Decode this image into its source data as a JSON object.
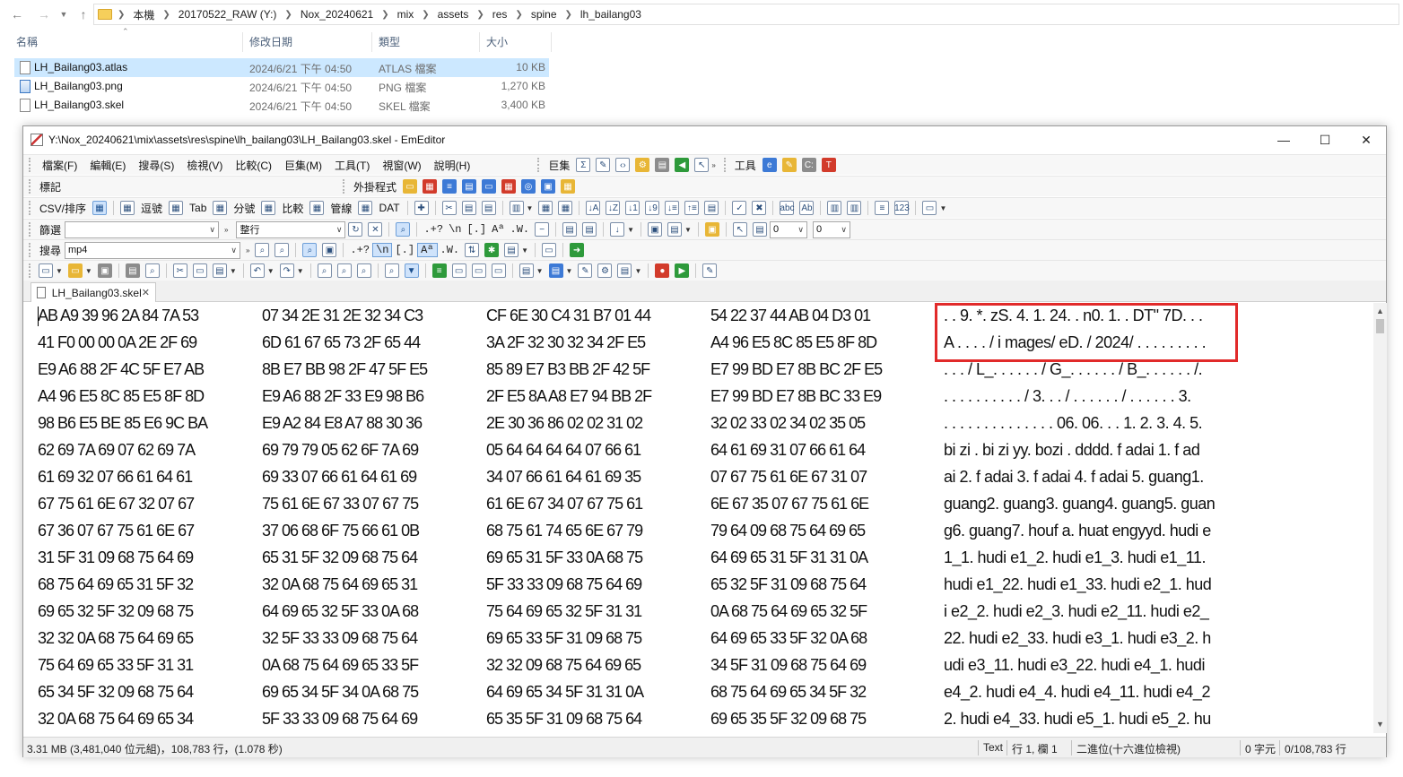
{
  "explorer": {
    "breadcrumbs": [
      "本機",
      "20170522_RAW (Y:)",
      "Nox_20240621",
      "mix",
      "assets",
      "res",
      "spine",
      "lh_bailang03"
    ],
    "columns": {
      "name": "名稱",
      "date": "修改日期",
      "type": "類型",
      "size": "大小"
    },
    "files": [
      {
        "name": "LH_Bailang03.atlas",
        "date": "2024/6/21 下午 04:50",
        "type": "ATLAS 檔案",
        "size": "10 KB",
        "selected": true
      },
      {
        "name": "LH_Bailang03.png",
        "date": "2024/6/21 下午 04:50",
        "type": "PNG 檔案",
        "size": "1,270 KB",
        "selected": false
      },
      {
        "name": "LH_Bailang03.skel",
        "date": "2024/6/21 下午 04:50",
        "type": "SKEL 檔案",
        "size": "3,400 KB",
        "selected": false
      }
    ]
  },
  "editor": {
    "title": "Y:\\Nox_20240621\\mix\\assets\\res\\spine\\lh_bailang03\\LH_Bailang03.skel - EmEditor",
    "menu": [
      "檔案(F)",
      "編輯(E)",
      "搜尋(S)",
      "檢視(V)",
      "比較(C)",
      "巨集(M)",
      "工具(T)",
      "視窗(W)",
      "說明(H)"
    ],
    "macros_label": "巨集",
    "tools_label": "工具",
    "bookmarks_label": "標記",
    "plugins_label": "外掛程式",
    "csv_toolbar": {
      "csv_sort": "CSV/排序",
      "comma": "逗號",
      "tab": "Tab",
      "semicolon": "分號",
      "compare": "比較",
      "pipe": "管線",
      "dat": "DAT"
    },
    "filter": {
      "label": "篩選",
      "value": "",
      "mode": "整行",
      "num1": "0",
      "num2": "0"
    },
    "search": {
      "label": "搜尋",
      "value": "mp4"
    },
    "tab_label": "LH_Bailang03.skel",
    "hex_lines": [
      {
        "hex": [
          "AB A9 39 96 2A 84 7A 53",
          "07 34 2E 31 2E 32 34 C3",
          "CF 6E 30 C4 31 B7 01 44",
          "54 22 37 44 AB 04 D3 01"
        ],
        "ascii": ". . 9. *. zS. 4. 1. 24. . n0. 1. . DT\" 7D. . ."
      },
      {
        "hex": [
          "41 F0 00 00 0A 2E 2F 69",
          "6D 61 67 65 73 2F 65 44",
          "3A 2F 32 30 32 34 2F E5",
          "A4 96 E5 8C 85 E5 8F 8D"
        ],
        "ascii": "A . . . . / i mages/ eD. / 2024/ . . . . . . . . ."
      },
      {
        "hex": [
          "E9 A6 88 2F 4C 5F E7 AB",
          "8B E7 BB 98 2F 47 5F E5",
          "85 89 E7 B3 BB 2F 42 5F",
          "E7 99 BD E7 8B BC 2F E5"
        ],
        "ascii": ". . . / L_. . . . . . / G_. . . . . . / B_. . . . . . /."
      },
      {
        "hex": [
          "A4 96 E5 8C 85 E5 8F 8D",
          "E9 A6 88 2F 33 E9 98 B6",
          "2F E5 8A A8 E7 94 BB 2F",
          "E7 99 BD E7 8B BC 33 E9"
        ],
        "ascii": ". . . . . . . . . . / 3. . . / . . . . . . / . . . . . . 3."
      },
      {
        "hex": [
          "98 B6 E5 BE 85 E6 9C BA",
          "E9 A2 84 E8 A7 88 30 36",
          "2E 30 36 86 02 02 31 02",
          "32 02 33 02 34 02 35 05"
        ],
        "ascii": ". . . . . . . . . . . . . . 06. 06. . . 1. 2. 3. 4. 5."
      },
      {
        "hex": [
          "62 69 7A 69 07 62 69 7A",
          "69 79 79 05 62 6F 7A 69",
          "05 64 64 64 64 07 66 61",
          "64 61 69 31 07 66 61 64"
        ],
        "ascii": "bi zi . bi zi yy. bozi . dddd. f adai 1. f ad"
      },
      {
        "hex": [
          "61 69 32 07 66 61 64 61",
          "69 33 07 66 61 64 61 69",
          "34 07 66 61 64 61 69 35",
          "07 67 75 61 6E 67 31 07"
        ],
        "ascii": "ai 2. f adai 3. f adai 4. f adai 5. guang1."
      },
      {
        "hex": [
          "67 75 61 6E 67 32 07 67",
          "75 61 6E 67 33 07 67 75",
          "61 6E 67 34 07 67 75 61",
          "6E 67 35 07 67 75 61 6E"
        ],
        "ascii": "guang2. guang3. guang4. guang5. guan"
      },
      {
        "hex": [
          "67 36 07 67 75 61 6E 67",
          "37 06 68 6F 75 66 61 0B",
          "68 75 61 74 65 6E 67 79",
          "79 64 09 68 75 64 69 65"
        ],
        "ascii": "g6. guang7. houf a. huat engyyd. hudi e"
      },
      {
        "hex": [
          "31 5F 31 09 68 75 64 69",
          "65 31 5F 32 09 68 75 64",
          "69 65 31 5F 33 0A 68 75",
          "64 69 65 31 5F 31 31 0A"
        ],
        "ascii": "1_1. hudi e1_2. hudi e1_3. hudi e1_11."
      },
      {
        "hex": [
          "68 75 64 69 65 31 5F 32",
          "32 0A 68 75 64 69 65 31",
          "5F 33 33 09 68 75 64 69",
          "65 32 5F 31 09 68 75 64"
        ],
        "ascii": "hudi e1_22. hudi e1_33. hudi e2_1. hud"
      },
      {
        "hex": [
          "69 65 32 5F 32 09 68 75",
          "64 69 65 32 5F 33 0A 68",
          "75 64 69 65 32 5F 31 31",
          "0A 68 75 64 69 65 32 5F"
        ],
        "ascii": "i e2_2. hudi e2_3. hudi e2_11. hudi e2_"
      },
      {
        "hex": [
          "32 32 0A 68 75 64 69 65",
          "32 5F 33 33 09 68 75 64",
          "69 65 33 5F 31 09 68 75",
          "64 69 65 33 5F 32 0A 68"
        ],
        "ascii": "22. hudi e2_33. hudi e3_1. hudi e3_2. h"
      },
      {
        "hex": [
          "75 64 69 65 33 5F 31 31",
          "0A 68 75 64 69 65 33 5F",
          "32 32 09 68 75 64 69 65",
          "34 5F 31 09 68 75 64 69"
        ],
        "ascii": "udi e3_11. hudi e3_22. hudi e4_1. hudi"
      },
      {
        "hex": [
          "65 34 5F 32 09 68 75 64",
          "69 65 34 5F 34 0A 68 75",
          "64 69 65 34 5F 31 31 0A",
          "68 75 64 69 65 34 5F 32"
        ],
        "ascii": "e4_2. hudi e4_4. hudi e4_11. hudi e4_2"
      },
      {
        "hex": [
          "32 0A 68 75 64 69 65 34",
          "5F 33 33 09 68 75 64 69",
          "65 35 5F 31 09 68 75 64",
          "69 65 35 5F 32 09 68 75"
        ],
        "ascii": "2. hudi e4_33. hudi e5_1. hudi e5_2. hu"
      }
    ],
    "status": {
      "size": "3.31 MB (3,481,040 位元組)，108,783 行，(1.078 秒)",
      "mode": "Text",
      "position": "行 1, 欄 1",
      "view": "二進位(十六進位檢視)",
      "chars": "0 字元",
      "lines": "0/108,783 行"
    }
  }
}
